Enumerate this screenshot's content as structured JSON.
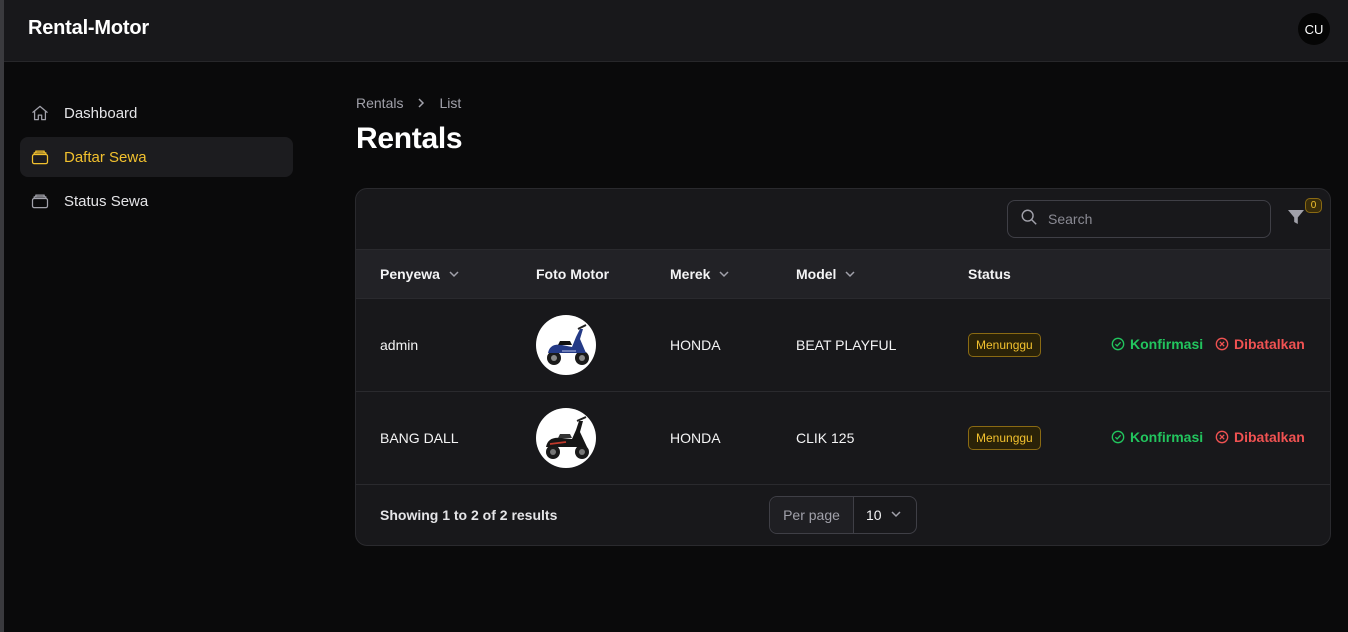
{
  "app": {
    "brand": "Rental-Motor",
    "user_initials": "CU"
  },
  "sidebar": {
    "items": [
      {
        "label": "Dashboard",
        "icon": "home-icon",
        "active": false
      },
      {
        "label": "Daftar Sewa",
        "icon": "archive-icon",
        "active": true
      },
      {
        "label": "Status Sewa",
        "icon": "archive-icon",
        "active": false
      }
    ]
  },
  "breadcrumb": {
    "parent": "Rentals",
    "current": "List"
  },
  "page": {
    "title": "Rentals"
  },
  "table": {
    "search_placeholder": "Search",
    "filter_count": "0",
    "columns": [
      "Penyewa",
      "Foto Motor",
      "Merek",
      "Model",
      "Status"
    ],
    "rows": [
      {
        "penyewa": "admin",
        "foto": "scooter-photo",
        "merek": "HONDA",
        "model": "BEAT PLAYFUL",
        "status": "Menunggu",
        "confirm": "Konfirmasi",
        "cancel": "Dibatalkan"
      },
      {
        "penyewa": "BANG DALL",
        "foto": "scooter-photo",
        "merek": "HONDA",
        "model": "CLIK 125",
        "status": "Menunggu",
        "confirm": "Konfirmasi",
        "cancel": "Dibatalkan"
      }
    ],
    "footer": {
      "showing": "Showing 1 to 2 of 2 results",
      "per_page_label": "Per page",
      "per_page_value": "10"
    }
  },
  "colors": {
    "accent": "#f2c12e",
    "confirm": "#22c55e",
    "cancel": "#f05252",
    "background": "#0a0a0b",
    "surface": "#18181b"
  }
}
